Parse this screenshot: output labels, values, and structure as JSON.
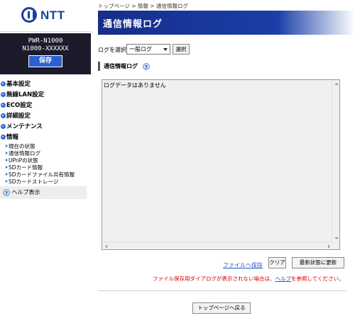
{
  "brand": {
    "logo_text": "NTT"
  },
  "device": {
    "model": "PWR-N1000",
    "serial": "N1000-XXXXXX",
    "save_label": "保存"
  },
  "sidebar": {
    "items": [
      {
        "label": "基本設定"
      },
      {
        "label": "無線LAN設定"
      },
      {
        "label": "ECO設定"
      },
      {
        "label": "詳細設定"
      },
      {
        "label": "メンテナンス"
      },
      {
        "label": "情報"
      }
    ],
    "sub_items": [
      {
        "label": "現在の状態"
      },
      {
        "label": "通信情報ログ"
      },
      {
        "label": "UPnPの状態"
      },
      {
        "label": "SDカード情報"
      },
      {
        "label": "SDカードファイル共有情報"
      },
      {
        "label": "SDカードストレージ"
      }
    ],
    "help": {
      "label": "ヘルプ表示",
      "icon": "question-icon"
    }
  },
  "main": {
    "breadcrumb": "トップページ > 情報 > 通信情報ログ",
    "title": "通信情報ログ",
    "select_label": "ログを選択",
    "select_value": "一般ログ",
    "select_button": "選択",
    "section_title": "通信情報ログ",
    "log_text": "ログデータはありません",
    "save_file_link": "ファイルへ保存",
    "clear_button": "クリア",
    "refresh_button": "最新状態に更新",
    "notice_before": "ファイル保存用ダイアログが表示されない場合は、",
    "notice_link": "ヘルプ",
    "notice_after": "を参照してください。",
    "top_button": "トップページへ戻る"
  },
  "colors": {
    "accent": "#1a3fa8",
    "sidebar_dark": "#1b1b2b",
    "notice": "#d40000",
    "link": "#1a56c8"
  }
}
